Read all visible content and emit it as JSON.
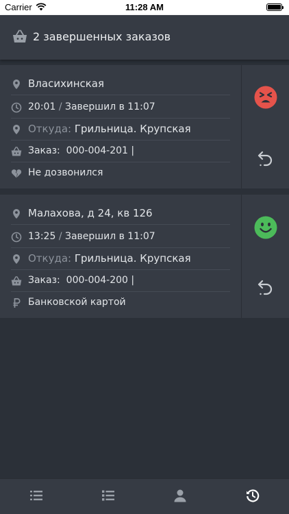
{
  "status_bar": {
    "carrier": "Carrier",
    "time": "11:28 AM"
  },
  "header": {
    "title": "2 завершенных заказов",
    "icon": "basket-icon"
  },
  "orders": [
    {
      "address": "Власихинская",
      "time": "20:01",
      "status": "Завершил в 11:07",
      "from_label": "Откуда:",
      "from_value": "Грильница. Крупская",
      "order_label": "Заказ:",
      "order_value": "000-004-201 |",
      "note": "Не дозвонился",
      "note_icon": "broken-heart-icon",
      "mood": "angry",
      "mood_color": "#e5534b"
    },
    {
      "address": "Малахова, д 24, кв 126",
      "time": "13:25",
      "status": "Завершил в 11:07",
      "from_label": "Откуда:",
      "from_value": "Грильница. Крупская",
      "order_label": "Заказ:",
      "order_value": "000-004-200 |",
      "note": "Банковской картой",
      "note_icon": "ruble-icon",
      "mood": "happy",
      "mood_color": "#4cbb5a"
    }
  ],
  "tabbar": {
    "tabs": [
      "list-icon",
      "checklist-icon",
      "profile-icon",
      "history-icon"
    ],
    "active": "history-icon"
  }
}
